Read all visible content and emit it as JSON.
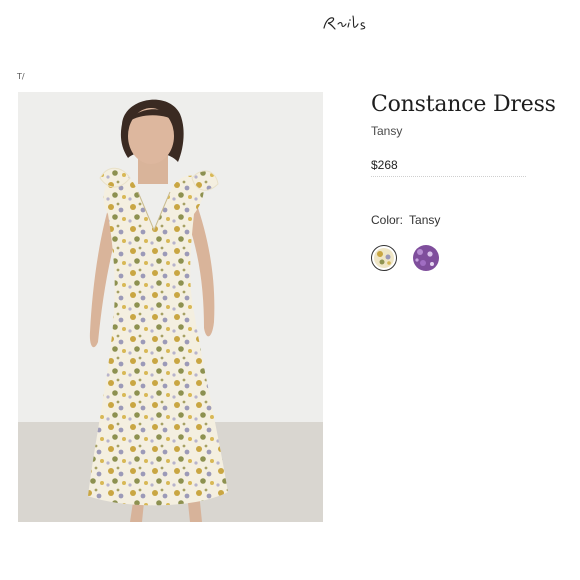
{
  "header": {
    "brand_logo_text": "Rails"
  },
  "breadcrumb": {
    "text": "T/"
  },
  "product": {
    "name": "Constance Dress",
    "variant": "Tansy",
    "price": "$268",
    "color_label": "Color:",
    "color_value": "Tansy",
    "swatches": [
      {
        "name": "Tansy",
        "selected": true,
        "color": "#e9dcae",
        "icon": "floral-print-swatch"
      },
      {
        "name": "Purple floral",
        "selected": false,
        "color": "#8c5aa8",
        "icon": "purple-floral-swatch"
      }
    ]
  },
  "colors": {
    "background": "#ffffff",
    "text": "#222222",
    "swatch_ring": "#333333"
  }
}
